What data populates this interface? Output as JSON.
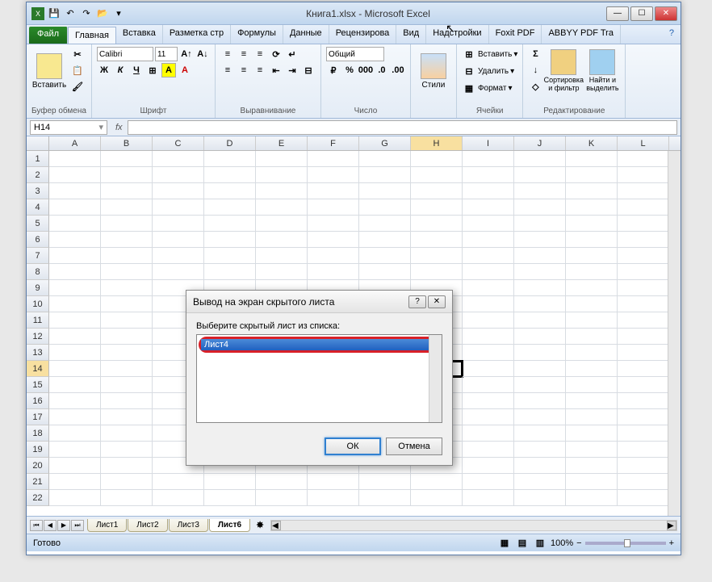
{
  "title": {
    "doc": "Книга1.xlsx",
    "app": "Microsoft Excel"
  },
  "tabs": {
    "file": "Файл",
    "items": [
      "Главная",
      "Вставка",
      "Разметка стр",
      "Формулы",
      "Данные",
      "Рецензирова",
      "Вид",
      "Надстройки",
      "Foxit PDF",
      "ABBYY PDF Tra"
    ]
  },
  "ribbon": {
    "clipboard": {
      "paste": "Вставить",
      "label": "Буфер обмена"
    },
    "font": {
      "name": "Calibri",
      "size": "11",
      "label": "Шрифт"
    },
    "alignment": {
      "label": "Выравнивание"
    },
    "number": {
      "format": "Общий",
      "label": "Число"
    },
    "styles": {
      "btn": "Стили",
      "label": ""
    },
    "cells": {
      "insert": "Вставить",
      "delete": "Удалить",
      "format": "Формат",
      "label": "Ячейки"
    },
    "editing": {
      "sort": "Сортировка и фильтр",
      "find": "Найти и выделить",
      "label": "Редактирование"
    }
  },
  "namebox": "H14",
  "fx": "fx",
  "columns": [
    "A",
    "B",
    "C",
    "D",
    "E",
    "F",
    "G",
    "H",
    "I",
    "J",
    "K",
    "L"
  ],
  "rows_count": 22,
  "active": {
    "col": "H",
    "row": 14
  },
  "sheets": {
    "items": [
      "Лист1",
      "Лист2",
      "Лист3",
      "Лист6"
    ],
    "active": 3
  },
  "status": {
    "ready": "Готово",
    "zoom": "100%"
  },
  "dialog": {
    "title": "Вывод на экран скрытого листа",
    "label": "Выберите скрытый лист из списка:",
    "item": "Лист4",
    "ok": "ОК",
    "cancel": "Отмена"
  }
}
